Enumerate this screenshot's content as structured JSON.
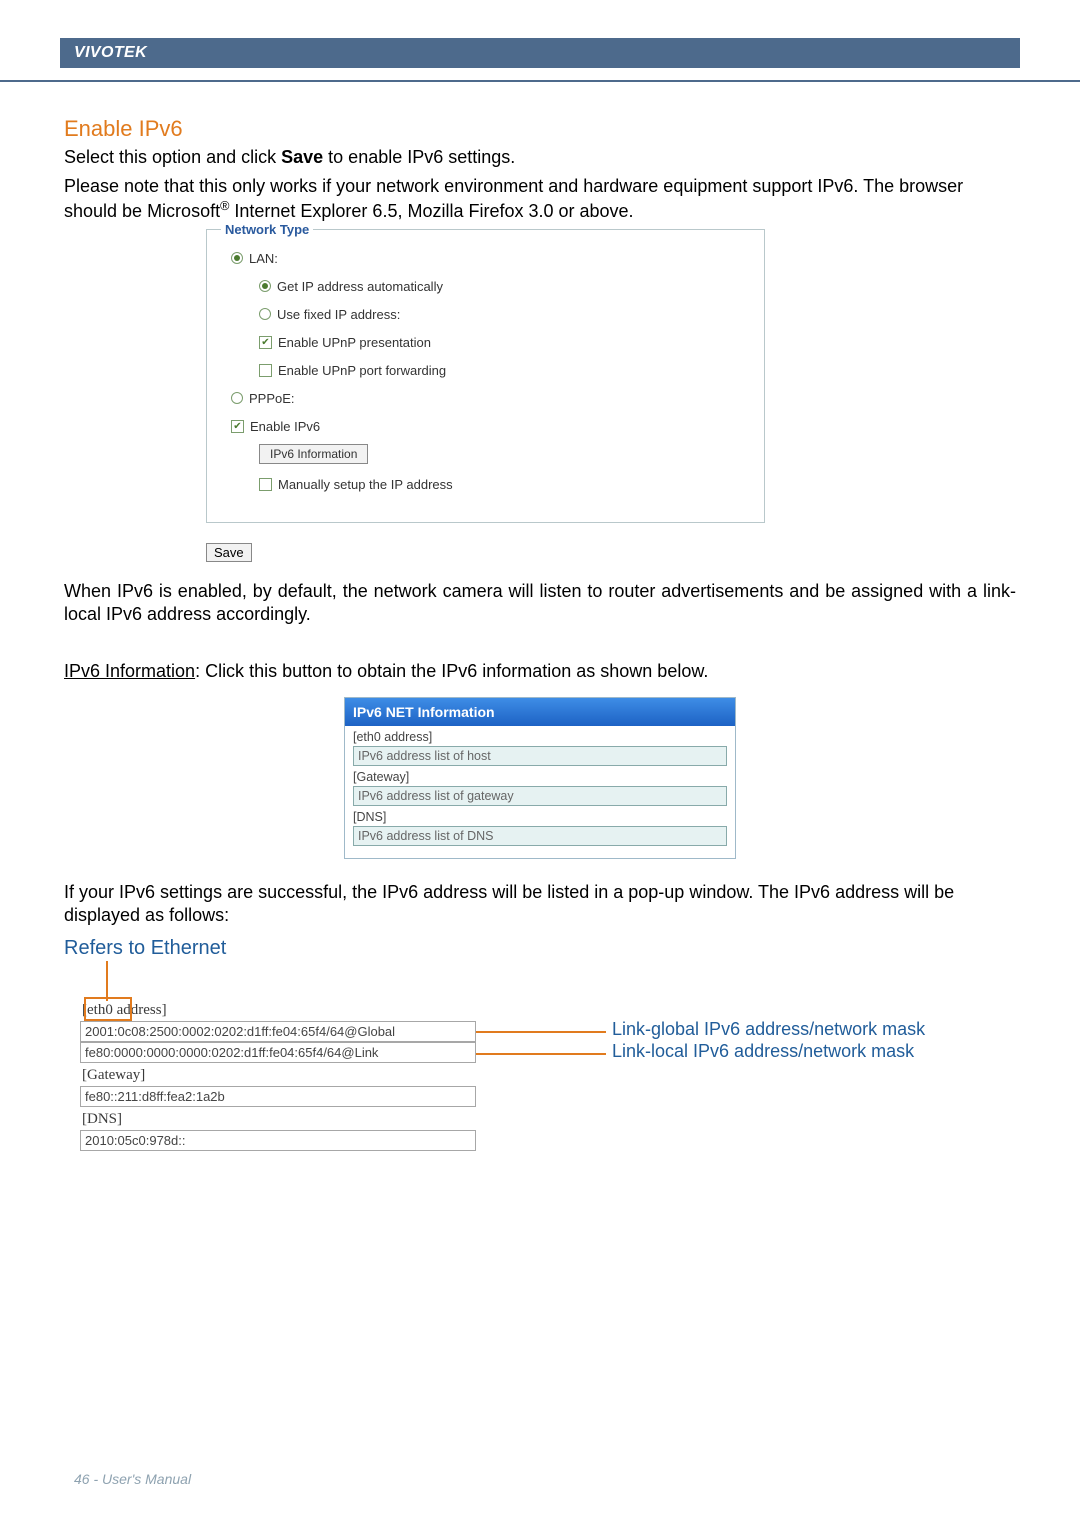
{
  "header": {
    "brand": "VIVOTEK"
  },
  "section1": {
    "title": "Enable IPv6",
    "p1_a": "Select this option and click ",
    "p1_bold": "Save",
    "p1_b": " to enable IPv6 settings.",
    "p2_a": "Please note that this only works if your network environment and hardware equipment support IPv6. The browser should be Microsoft",
    "p2_sup": "®",
    "p2_b": " Internet Explorer 6.5, Mozilla Firefox 3.0 or above."
  },
  "screenshot1": {
    "legend": "Network Type",
    "lan": "LAN:",
    "getip": "Get IP address automatically",
    "fixed": "Use fixed IP address:",
    "upnp_pres": "Enable UPnP presentation",
    "upnp_port": "Enable UPnP port forwarding",
    "pppoe": "PPPoE:",
    "enable_ipv6": "Enable IPv6",
    "ipv6_info_btn": "IPv6 Information",
    "manual_ip": "Manually setup the IP address",
    "save_btn": "Save"
  },
  "para_after_ss1": "When IPv6 is enabled, by default, the network camera will listen to router advertisements and be assigned with a link-local IPv6 address accordingly.",
  "ipv6info_line": {
    "u": "IPv6 Information",
    "rest": ": Click this button to obtain the IPv6 information as shown below."
  },
  "screenshot2": {
    "title": "IPv6 NET Information",
    "r1": "[eth0 address]",
    "f1": "IPv6 address list of host",
    "r2": "[Gateway]",
    "f2": "IPv6 address list of gateway",
    "r3": "[DNS]",
    "f3": "IPv6 address list of DNS"
  },
  "para_after_ss2": "If your IPv6 settings are successful, the IPv6 address will be listed in a pop-up window. The IPv6 address will be displayed as follows:",
  "eth": {
    "title": "Refers to Ethernet",
    "eth0_label_a": "[eth0",
    "eth0_label_b": " address]",
    "globalAddr": "2001:0c08:2500:0002:0202:d1ff:fe04:65f4/64@Global",
    "linkAddr": "fe80:0000:0000:0000:0202:d1ff:fe04:65f4/64@Link",
    "gateway_label": "[Gateway]",
    "gatewayAddr": "fe80::211:d8ff:fea2:1a2b",
    "dns_label": "[DNS]",
    "dnsAddr": "2010:05c0:978d::",
    "ann_global": "Link-global IPv6 address/network mask",
    "ann_local": "Link-local IPv6 address/network mask"
  },
  "footer": "46 - User's Manual"
}
